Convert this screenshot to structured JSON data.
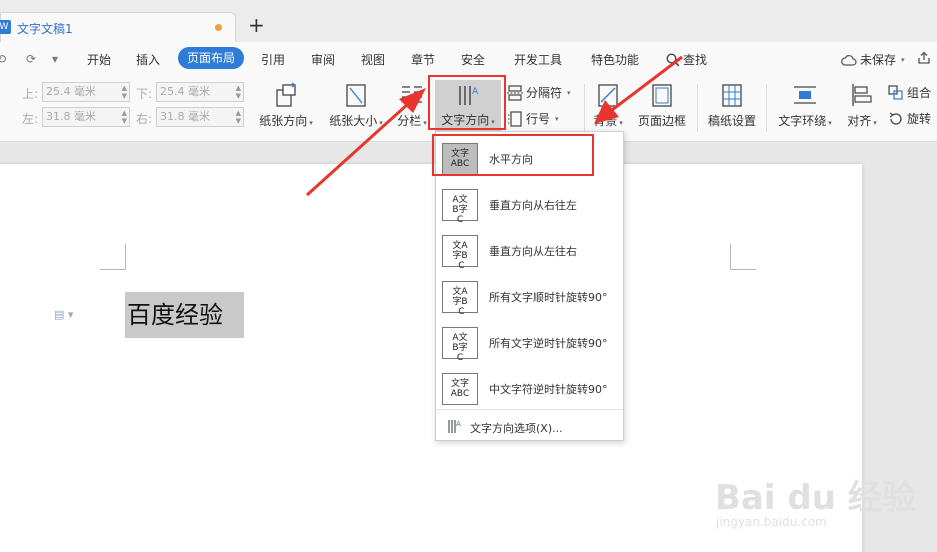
{
  "tab": {
    "doc_icon": "W",
    "title": "文字文稿1",
    "new_tab": "+"
  },
  "quick_access": {
    "undo": "⟲",
    "redo": "⟳",
    "more": "▾"
  },
  "menu": {
    "items": [
      "开始",
      "插入",
      "页面布局",
      "引用",
      "审阅",
      "视图",
      "章节",
      "安全",
      "开发工具",
      "特色功能"
    ],
    "active": "页面布局",
    "search": "查找",
    "unsaved": "未保存",
    "share_icon": "share-icon"
  },
  "margins": {
    "top_label": "上:",
    "top_value": "25.4 毫米",
    "bottom_label": "下:",
    "bottom_value": "25.4 毫米",
    "left_label": "左:",
    "left_value": "31.8 毫米",
    "right_label": "右:",
    "right_value": "31.8 毫米"
  },
  "ribbon": {
    "orientation": "纸张方向",
    "size": "纸张大小",
    "columns": "分栏",
    "text_direction": "文字方向",
    "breaks": "分隔符",
    "line_numbers": "行号",
    "background": "背景",
    "page_border": "页面边框",
    "paper_setup": "稿纸设置",
    "text_wrap": "文字环绕",
    "align": "对齐",
    "group": "组合",
    "rotate": "旋转"
  },
  "document": {
    "selected_text": "百度经验"
  },
  "dropdown": {
    "items": [
      {
        "label": "水平方向",
        "icon_text": "文字 ABC",
        "icon": "horizontal-text-icon"
      },
      {
        "label": "垂直方向从右往左",
        "icon_text": "ABC 文字",
        "icon": "vertical-rtl-icon"
      },
      {
        "label": "垂直方向从左往右",
        "icon_text": "文字 ABC",
        "icon": "vertical-ltr-icon"
      },
      {
        "label": "所有文字顺时针旋转90°",
        "icon_text": "ABC 文字",
        "icon": "rotate-cw-icon"
      },
      {
        "label": "所有文字逆时针旋转90°",
        "icon_text": "ABC 文字",
        "icon": "rotate-ccw-icon"
      },
      {
        "label": "中文字符逆时针旋转90°",
        "icon_text": "文字 ABC",
        "icon": "cjk-rotate-icon"
      }
    ],
    "footer": "文字方向选项(X)..."
  },
  "watermark": {
    "brand": "Bai du 经验",
    "url": "jingyan.baidu.com"
  },
  "colors": {
    "accent": "#2f7bd8",
    "annotation": "#e8352f"
  }
}
